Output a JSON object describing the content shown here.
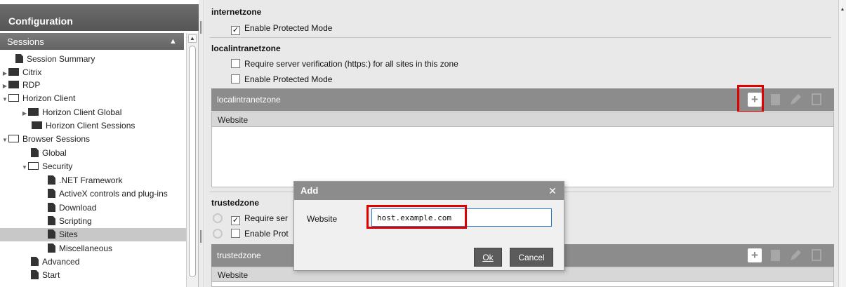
{
  "sidebar": {
    "title": "Configuration",
    "sessions_label": "Sessions",
    "tree": [
      {
        "label": "Session Summary"
      },
      {
        "label": "Citrix"
      },
      {
        "label": "RDP"
      },
      {
        "label": "Horizon Client"
      },
      {
        "label": "Horizon Client Global"
      },
      {
        "label": "Horizon Client Sessions"
      },
      {
        "label": "Browser Sessions"
      },
      {
        "label": "Global"
      },
      {
        "label": "Security"
      },
      {
        "label": ".NET Framework"
      },
      {
        "label": "ActiveX controls and plug-ins"
      },
      {
        "label": "Download"
      },
      {
        "label": "Scripting"
      },
      {
        "label": "Sites"
      },
      {
        "label": "Miscellaneous"
      },
      {
        "label": "Advanced"
      },
      {
        "label": "Start"
      }
    ]
  },
  "main": {
    "internetzone": {
      "title": "internetzone",
      "enable_protected_mode": "Enable Protected Mode",
      "enable_protected_mode_checked": true
    },
    "localintranetzone": {
      "title": "localintranetzone",
      "require_verification": "Require server verification (https:) for all sites in this zone",
      "require_verification_checked": false,
      "enable_protected_mode": "Enable Protected Mode",
      "enable_protected_mode_checked": false,
      "grid_title": "localintranetzone",
      "grid_column": "Website"
    },
    "trustedzone": {
      "title": "trustedzone",
      "require_verification": "Require ser",
      "require_verification_checked": true,
      "enable_protected_mode": "Enable Prot",
      "enable_protected_mode_checked": false,
      "grid_title": "trustedzone",
      "grid_column": "Website"
    }
  },
  "dialog": {
    "title": "Add",
    "field_label": "Website",
    "field_value": "host.example.com",
    "ok_label": "Ok",
    "cancel_label": "Cancel"
  },
  "icons": {
    "add": "add-icon",
    "delete": "delete-icon",
    "edit": "pencil-icon",
    "copy": "copy-icon",
    "close": "close-icon",
    "reset": "reset-icon"
  },
  "colors": {
    "highlight": "#e00000",
    "header_gray": "#8c8c8c",
    "selected_row": "#c8c8c8"
  }
}
